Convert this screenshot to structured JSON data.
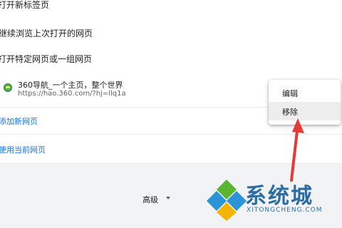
{
  "startup_options": {
    "open_new_tab": "打开新标签页",
    "continue_last": "继续浏览上次打开的网页",
    "open_specific": "打开特定网页或一组网页"
  },
  "site": {
    "title": "360导航_一个主页，整个世界",
    "url": "https://hao.360.com/?hj=llq1a"
  },
  "links": {
    "add_new_page": "添加新网页",
    "use_current_pages": "使用当前网页"
  },
  "bottom": {
    "advanced_label": "高级"
  },
  "context_menu": {
    "edit": "编辑",
    "remove": "移除"
  },
  "watermark": {
    "text": "系统城",
    "url": "XITONGCHENG.COM"
  },
  "colors": {
    "link": "#1a73e8",
    "arrow": "#e53935",
    "watermark": "#2d6ca2"
  }
}
